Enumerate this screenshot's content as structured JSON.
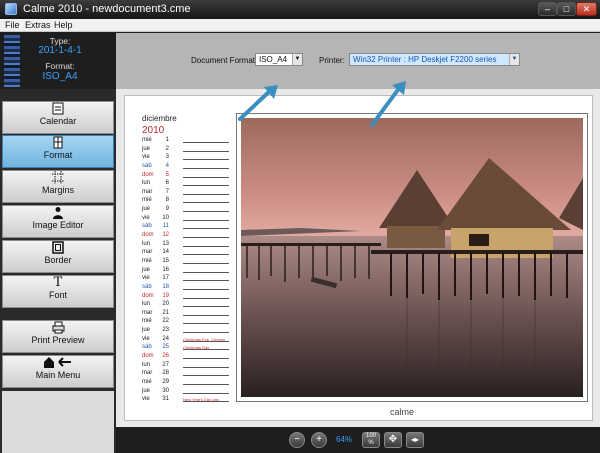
{
  "window": {
    "title": "Calme 2010 - newdocument3.cme"
  },
  "menu": [
    "File",
    "Extras",
    "Help"
  ],
  "info": {
    "type_label": "Type:",
    "type_value": "201-1-4-1",
    "format_label": "Format:",
    "format_value": "ISO_A4"
  },
  "toolbar": {
    "document_format_label": "Document Format:",
    "document_format_value": "ISO_A4",
    "printer_label": "Printer:",
    "printer_value": "Win32 Printer : HP Deskjet F2200 series"
  },
  "sidebar": [
    {
      "label": "Calendar",
      "icon": "calendar-icon",
      "active": false
    },
    {
      "label": "Format",
      "icon": "format-icon",
      "active": true
    },
    {
      "label": "Margins",
      "icon": "margins-icon",
      "active": false
    },
    {
      "label": "Image Editor",
      "icon": "image-editor-icon",
      "active": false
    },
    {
      "label": "Border",
      "icon": "border-icon",
      "active": false
    },
    {
      "label": "Font",
      "icon": "font-icon",
      "active": false
    },
    {
      "label": "Print Preview",
      "icon": "printer-icon",
      "active": false
    },
    {
      "label": "Main Menu",
      "icon": "home-back-icon",
      "active": false
    }
  ],
  "calendar": {
    "month": "diciembre",
    "year": "2010",
    "days": [
      {
        "n": "1",
        "d": "mié"
      },
      {
        "n": "2",
        "d": "jue"
      },
      {
        "n": "3",
        "d": "vie"
      },
      {
        "n": "4",
        "d": "sáb"
      },
      {
        "n": "5",
        "d": "dom"
      },
      {
        "n": "6",
        "d": "lun"
      },
      {
        "n": "7",
        "d": "mar"
      },
      {
        "n": "8",
        "d": "mié"
      },
      {
        "n": "9",
        "d": "jue"
      },
      {
        "n": "10",
        "d": "vie"
      },
      {
        "n": "11",
        "d": "sáb"
      },
      {
        "n": "12",
        "d": "dom"
      },
      {
        "n": "13",
        "d": "lun"
      },
      {
        "n": "14",
        "d": "mar"
      },
      {
        "n": "15",
        "d": "mié"
      },
      {
        "n": "16",
        "d": "jue"
      },
      {
        "n": "17",
        "d": "vie"
      },
      {
        "n": "18",
        "d": "sáb"
      },
      {
        "n": "19",
        "d": "dom"
      },
      {
        "n": "20",
        "d": "lun"
      },
      {
        "n": "21",
        "d": "mar"
      },
      {
        "n": "22",
        "d": "mié"
      },
      {
        "n": "23",
        "d": "jue"
      },
      {
        "n": "24",
        "d": "vie",
        "note": "Christmas Eve, Christm"
      },
      {
        "n": "25",
        "d": "sáb",
        "note": "Christmas Day"
      },
      {
        "n": "26",
        "d": "dom"
      },
      {
        "n": "27",
        "d": "lun"
      },
      {
        "n": "28",
        "d": "mar"
      },
      {
        "n": "29",
        "d": "mié"
      },
      {
        "n": "30",
        "d": "jue"
      },
      {
        "n": "31",
        "d": "vie",
        "note": "New Year's Day obs."
      }
    ]
  },
  "logo": {
    "text": "calme"
  },
  "bottom": {
    "zoom": "64%",
    "fit_label": "100 %"
  },
  "colors": {
    "accent": "#39a2ff",
    "sunday": "#c0282a",
    "saturday": "#2655a8",
    "active_nav": "#7dbbe3"
  }
}
